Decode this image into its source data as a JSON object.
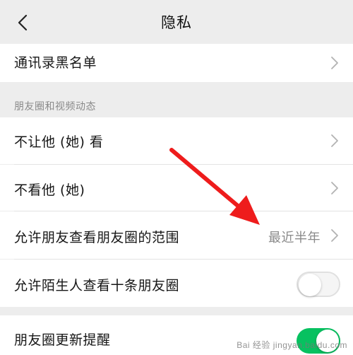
{
  "header": {
    "title": "隐私"
  },
  "rows": {
    "blacklist": {
      "label": "通讯录黑名单"
    },
    "section_moments": {
      "label": "朋友圈和视频动态"
    },
    "hide_my_moments": {
      "label": "不让他 (她) 看"
    },
    "hide_their_moments": {
      "label": "不看他 (她)"
    },
    "visible_range": {
      "label": "允许朋友查看朋友圈的范围",
      "value": "最近半年"
    },
    "stranger_ten": {
      "label": "允许陌生人查看十条朋友圈",
      "toggle": "off"
    },
    "update_notify": {
      "label": "朋友圈更新提醒",
      "toggle": "on"
    }
  },
  "annotation": {
    "arrow_color": "#ee1c1c"
  },
  "watermark": {
    "text": "Bai 经验 jingyan.baidu.com"
  },
  "colors": {
    "background": "#ededed",
    "row": "#ffffff",
    "accent_green": "#07c160",
    "secondary_text": "#8a8a8a"
  }
}
